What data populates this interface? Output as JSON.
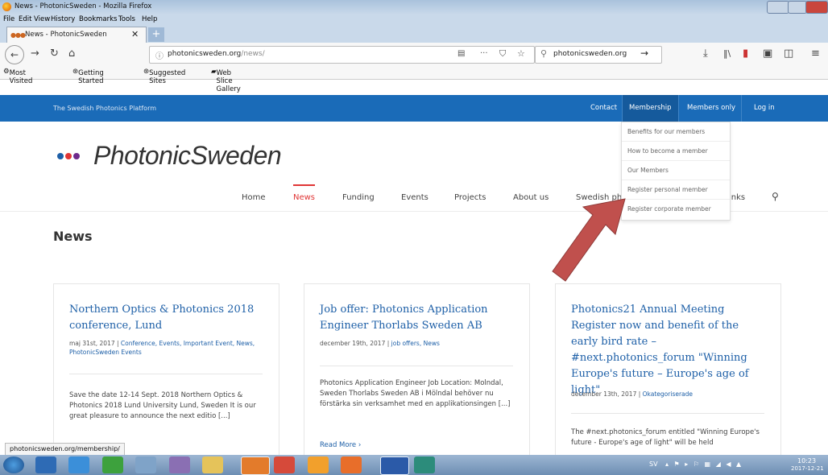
{
  "window": {
    "title": "News - PhotonicSweden - Mozilla Firefox"
  },
  "menu": [
    "File",
    "Edit",
    "View",
    "History",
    "Bookmarks",
    "Tools",
    "Help"
  ],
  "tab": {
    "label": "News - PhotonicSweden",
    "close": "✕",
    "new": "+"
  },
  "nav": {
    "url_domain": "photonicsweden.org",
    "url_path": "/news/",
    "search_value": "photonicsweden.org",
    "go": "→",
    "dots": "···"
  },
  "bookmarks": [
    "Most Visited",
    "Getting Started",
    "Suggested Sites",
    "Web Slice Gallery"
  ],
  "site": {
    "tagline": "The Swedish Photonics Platform",
    "topnav": [
      "Contact",
      "Membership",
      "Members only",
      "Log in"
    ],
    "logo": "PhotonicSweden",
    "logo_colors": [
      "#1d5fa7",
      "#e03535",
      "#6f2a8c"
    ],
    "mainnav": [
      "Home",
      "News",
      "Funding",
      "Events",
      "Projects",
      "About us",
      "Swedish ph",
      "inks"
    ],
    "search_icon": "search-icon",
    "page_heading": "News",
    "dropdown": [
      "Benefits for our members",
      "How to become a member",
      "Our Members",
      "Register personal member",
      "Register corporate member"
    ],
    "accent": "#1a6bb8"
  },
  "cards": [
    {
      "title": "Northern Optics & Photonics 2018 conference, Lund",
      "date": "maj 31st, 2017",
      "categories": "Conference, Events, Important Event, News, PhotonicSweden Events",
      "excerpt": "Save the date 12-14 Sept. 2018 Northern Optics & Photonics 2018 Lund University Lund, Sweden It is our great pleasure to announce the next editio [...]"
    },
    {
      "title": "Job offer: Photonics Application Engineer Thorlabs Sweden AB",
      "date": "december 19th, 2017",
      "categories": "job offers, News",
      "excerpt": "Photonics Application Engineer Job Location: Molndal, Sweden Thorlabs Sweden AB i Mölndal behöver nu förstärka sin verksamhet med en applikationsingen [...]",
      "read_more": "Read More ›"
    },
    {
      "title": "Photonics21 Annual Meeting Register now and benefit of the early bird rate – #next.photonics_forum \"Winning Europe's future – Europe's age of light\"",
      "date": "december 13th, 2017",
      "categories": "Okategoriserade",
      "excerpt": "The #next.photonics_forum entitled \"Winning Europe's future - Europe's age of light\" will be held"
    }
  ],
  "status_url": "photonicsweden.org/membership/",
  "tray": {
    "lang": "SV",
    "time": "10:23",
    "date": "2017-12-21"
  }
}
